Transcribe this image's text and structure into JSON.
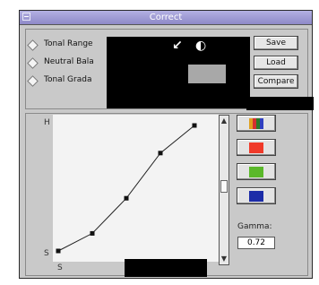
{
  "window": {
    "title": "Correct"
  },
  "radios": [
    {
      "label": "Tonal Range"
    },
    {
      "label": "Neutral Bala"
    },
    {
      "label": "Tonal Grada"
    }
  ],
  "buttons": {
    "save": "Save",
    "load": "Load",
    "compare": "Compare"
  },
  "icons": {
    "arrow": "↙",
    "circle": "◐"
  },
  "graph": {
    "y_label": "H",
    "y_label_bottom": "S",
    "x_label": "S",
    "points": [
      [
        0,
        0
      ],
      [
        0.25,
        0.14
      ],
      [
        0.5,
        0.42
      ],
      [
        0.75,
        0.78
      ],
      [
        1,
        1
      ]
    ]
  },
  "swatches": [
    {
      "name": "rgb-channel",
      "colors": [
        "#e0a020",
        "#d43030",
        "#2a7a2a",
        "#3040c0"
      ]
    },
    {
      "name": "red-channel",
      "color": "#f03a2a"
    },
    {
      "name": "green-channel",
      "color": "#5ab82a"
    },
    {
      "name": "blue-channel",
      "color": "#1c2ca8"
    }
  ],
  "gamma": {
    "label": "Gamma:",
    "value": "0.72"
  }
}
